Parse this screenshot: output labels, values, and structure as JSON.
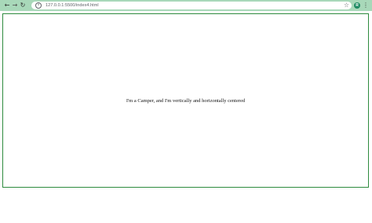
{
  "browser": {
    "back_icon": "←",
    "forward_icon": "→",
    "reload_icon": "↻",
    "info_icon": "i",
    "url": "127.0.0.1:5500/index4.html",
    "star_icon": "☆",
    "avatar_letter": "R",
    "menu_icon": "⋮",
    "colors": {
      "toolbar": "#a8d8b9",
      "avatar": "#1f8a63",
      "frame_border": "#2e8b3e"
    }
  },
  "page": {
    "text": "I'm a Camper, and I'm vertically and horizontally centered"
  }
}
